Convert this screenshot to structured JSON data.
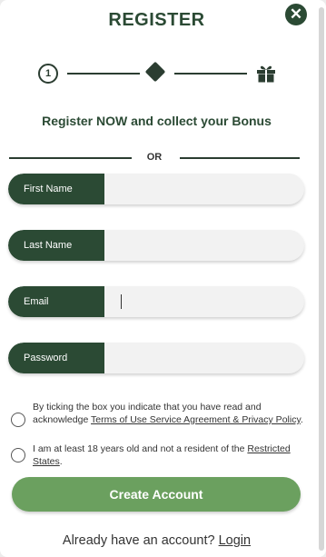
{
  "header": {
    "title": "REGISTER",
    "close_icon": "close-icon"
  },
  "stepper": {
    "step_number": "1",
    "icons": [
      "step-one-icon",
      "diamond-icon",
      "gift-icon"
    ]
  },
  "subtitle": "Register NOW and collect your Bonus",
  "divider_text": "OR",
  "form": {
    "first_name_label": "First Name",
    "last_name_label": "Last Name",
    "email_label": "Email",
    "password_label": "Password"
  },
  "consent": {
    "terms_prefix": "By ticking the box you indicate that you have read and acknowledge ",
    "terms_link": "Terms of Use Service Agreement & Privacy Policy",
    "terms_suffix": ".",
    "age_prefix": "I am at least 18 years old and not a resident of the ",
    "age_link": "Restricted States",
    "age_suffix": "."
  },
  "create_button": "Create Account",
  "footer": {
    "prompt": "Already have an account?",
    "login_link": "Login"
  },
  "colors": {
    "primary_dark_green": "#2b4a34",
    "button_green": "#6ba05f",
    "field_bg": "#f2f2f2"
  }
}
